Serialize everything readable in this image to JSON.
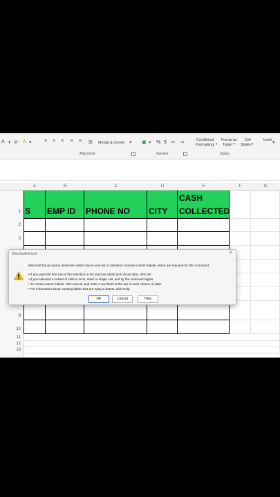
{
  "ribbon": {
    "merge_center": "Merge & Center",
    "number_format": "%",
    "comma": "9",
    "alignment_label": "Alignment",
    "number_label": "Number",
    "styles_label": "Styles",
    "conditional_top": "Conditional",
    "conditional": "Formatting",
    "format_as_top": "Format as",
    "format_as": "Table",
    "cell_styles_top": "Cell",
    "cell_styles": "Styles",
    "insert": "Insert"
  },
  "grid": {
    "columns": [
      "A",
      "B",
      "C",
      "D",
      "E",
      "F",
      "G"
    ],
    "rows": [
      "1",
      "2",
      "3",
      "9",
      "10",
      "11",
      "12",
      "13"
    ],
    "headers": {
      "a": "S",
      "b": "EMP ID",
      "c": "PHONE NO",
      "d": "CITY",
      "e1": "CASH",
      "e2": "COLLECTED"
    }
  },
  "dialog": {
    "title": "Microsoft Excel",
    "close": "×",
    "message": "Microsoft Excel cannot determine which row in your list or selection contains column labels, which are required for this command.",
    "bullets": [
      "• If you want the first row of the selection or list used as labels and not as data, click OK.",
      "• If you selected a subset of cells in error, select a single cell, and try the command again.",
      "• To create column labels, click Cancel, and enter a text label at the top of each column of data.",
      "• For information about creating labels that are easy to detect, click Help."
    ],
    "ok": "OK",
    "cancel": "Cancel",
    "help": "Help"
  },
  "colors": {
    "header_fill": "#22d15a",
    "warning": "#f2c200"
  }
}
